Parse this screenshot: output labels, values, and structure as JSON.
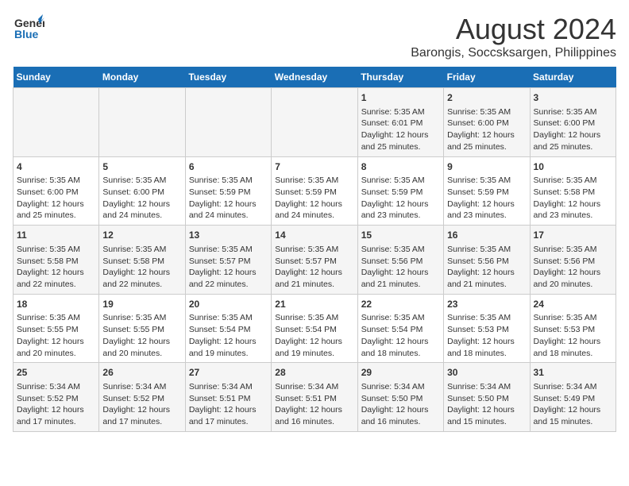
{
  "logo": {
    "line1": "General",
    "line2": "Blue"
  },
  "title": "August 2024",
  "subtitle": "Barongis, Soccsksargen, Philippines",
  "days_of_week": [
    "Sunday",
    "Monday",
    "Tuesday",
    "Wednesday",
    "Thursday",
    "Friday",
    "Saturday"
  ],
  "weeks": [
    [
      {
        "day": "",
        "info": ""
      },
      {
        "day": "",
        "info": ""
      },
      {
        "day": "",
        "info": ""
      },
      {
        "day": "",
        "info": ""
      },
      {
        "day": "1",
        "info": "Sunrise: 5:35 AM\nSunset: 6:01 PM\nDaylight: 12 hours and 25 minutes."
      },
      {
        "day": "2",
        "info": "Sunrise: 5:35 AM\nSunset: 6:00 PM\nDaylight: 12 hours and 25 minutes."
      },
      {
        "day": "3",
        "info": "Sunrise: 5:35 AM\nSunset: 6:00 PM\nDaylight: 12 hours and 25 minutes."
      }
    ],
    [
      {
        "day": "4",
        "info": "Sunrise: 5:35 AM\nSunset: 6:00 PM\nDaylight: 12 hours and 25 minutes."
      },
      {
        "day": "5",
        "info": "Sunrise: 5:35 AM\nSunset: 6:00 PM\nDaylight: 12 hours and 24 minutes."
      },
      {
        "day": "6",
        "info": "Sunrise: 5:35 AM\nSunset: 5:59 PM\nDaylight: 12 hours and 24 minutes."
      },
      {
        "day": "7",
        "info": "Sunrise: 5:35 AM\nSunset: 5:59 PM\nDaylight: 12 hours and 24 minutes."
      },
      {
        "day": "8",
        "info": "Sunrise: 5:35 AM\nSunset: 5:59 PM\nDaylight: 12 hours and 23 minutes."
      },
      {
        "day": "9",
        "info": "Sunrise: 5:35 AM\nSunset: 5:59 PM\nDaylight: 12 hours and 23 minutes."
      },
      {
        "day": "10",
        "info": "Sunrise: 5:35 AM\nSunset: 5:58 PM\nDaylight: 12 hours and 23 minutes."
      }
    ],
    [
      {
        "day": "11",
        "info": "Sunrise: 5:35 AM\nSunset: 5:58 PM\nDaylight: 12 hours and 22 minutes."
      },
      {
        "day": "12",
        "info": "Sunrise: 5:35 AM\nSunset: 5:58 PM\nDaylight: 12 hours and 22 minutes."
      },
      {
        "day": "13",
        "info": "Sunrise: 5:35 AM\nSunset: 5:57 PM\nDaylight: 12 hours and 22 minutes."
      },
      {
        "day": "14",
        "info": "Sunrise: 5:35 AM\nSunset: 5:57 PM\nDaylight: 12 hours and 21 minutes."
      },
      {
        "day": "15",
        "info": "Sunrise: 5:35 AM\nSunset: 5:56 PM\nDaylight: 12 hours and 21 minutes."
      },
      {
        "day": "16",
        "info": "Sunrise: 5:35 AM\nSunset: 5:56 PM\nDaylight: 12 hours and 21 minutes."
      },
      {
        "day": "17",
        "info": "Sunrise: 5:35 AM\nSunset: 5:56 PM\nDaylight: 12 hours and 20 minutes."
      }
    ],
    [
      {
        "day": "18",
        "info": "Sunrise: 5:35 AM\nSunset: 5:55 PM\nDaylight: 12 hours and 20 minutes."
      },
      {
        "day": "19",
        "info": "Sunrise: 5:35 AM\nSunset: 5:55 PM\nDaylight: 12 hours and 20 minutes."
      },
      {
        "day": "20",
        "info": "Sunrise: 5:35 AM\nSunset: 5:54 PM\nDaylight: 12 hours and 19 minutes."
      },
      {
        "day": "21",
        "info": "Sunrise: 5:35 AM\nSunset: 5:54 PM\nDaylight: 12 hours and 19 minutes."
      },
      {
        "day": "22",
        "info": "Sunrise: 5:35 AM\nSunset: 5:54 PM\nDaylight: 12 hours and 18 minutes."
      },
      {
        "day": "23",
        "info": "Sunrise: 5:35 AM\nSunset: 5:53 PM\nDaylight: 12 hours and 18 minutes."
      },
      {
        "day": "24",
        "info": "Sunrise: 5:35 AM\nSunset: 5:53 PM\nDaylight: 12 hours and 18 minutes."
      }
    ],
    [
      {
        "day": "25",
        "info": "Sunrise: 5:34 AM\nSunset: 5:52 PM\nDaylight: 12 hours and 17 minutes."
      },
      {
        "day": "26",
        "info": "Sunrise: 5:34 AM\nSunset: 5:52 PM\nDaylight: 12 hours and 17 minutes."
      },
      {
        "day": "27",
        "info": "Sunrise: 5:34 AM\nSunset: 5:51 PM\nDaylight: 12 hours and 17 minutes."
      },
      {
        "day": "28",
        "info": "Sunrise: 5:34 AM\nSunset: 5:51 PM\nDaylight: 12 hours and 16 minutes."
      },
      {
        "day": "29",
        "info": "Sunrise: 5:34 AM\nSunset: 5:50 PM\nDaylight: 12 hours and 16 minutes."
      },
      {
        "day": "30",
        "info": "Sunrise: 5:34 AM\nSunset: 5:50 PM\nDaylight: 12 hours and 15 minutes."
      },
      {
        "day": "31",
        "info": "Sunrise: 5:34 AM\nSunset: 5:49 PM\nDaylight: 12 hours and 15 minutes."
      }
    ]
  ]
}
